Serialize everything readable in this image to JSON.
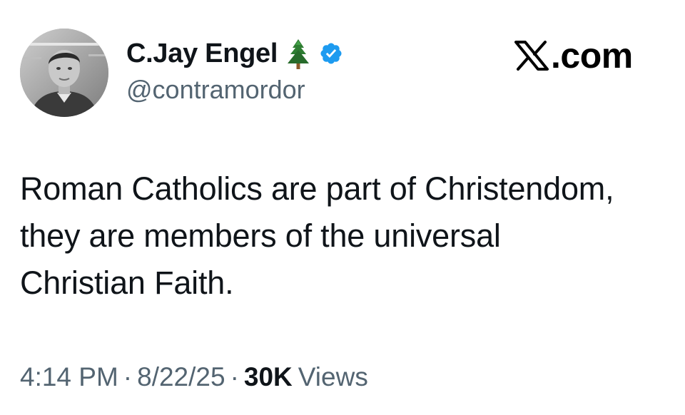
{
  "tweet": {
    "author": {
      "display_name": "C.Jay Engel",
      "handle": "@contramordor",
      "name_emoji": "evergreen-tree-icon",
      "verified": true,
      "verified_color": "#1d9bf0"
    },
    "brand": {
      "name": ".com",
      "icon": "x-logo-icon"
    },
    "text_lines": [
      "Roman Catholics are part of Christendom,",
      "they are members of the universal",
      "Christian Faith."
    ],
    "meta": {
      "time": "4:14 PM",
      "separator": "·",
      "date": "8/22/25",
      "views_count": "30K",
      "views_label": "Views"
    }
  },
  "colors": {
    "text_primary": "#0f1419",
    "text_secondary": "#536471",
    "background": "#ffffff"
  }
}
